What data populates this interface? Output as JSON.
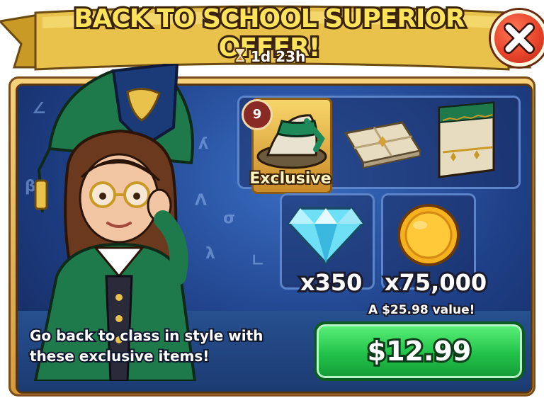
{
  "offer": {
    "title": "BACK TO SCHOOL SUPERIOR OFFER!",
    "timer": "1d 23h",
    "description": "Go back to class in style with these exclusive items!"
  },
  "items": {
    "hat_level": "9",
    "exclusive_label": "Exclusive"
  },
  "currencies": {
    "gems_amount": "x350",
    "gold_amount": "x75,000"
  },
  "purchase": {
    "value_text": "A $25.98 value!",
    "price": "$12.99"
  },
  "icons": [
    "hourglass-icon",
    "close-icon",
    "hat-icon",
    "tile-icon",
    "wall-icon",
    "gem-icon",
    "coin-icon"
  ],
  "colors": {
    "title_yellow": "#ffe35a",
    "close_red": "#e8452c",
    "buy_green": "#22c24a",
    "panel_blue": "#1e3f86"
  }
}
